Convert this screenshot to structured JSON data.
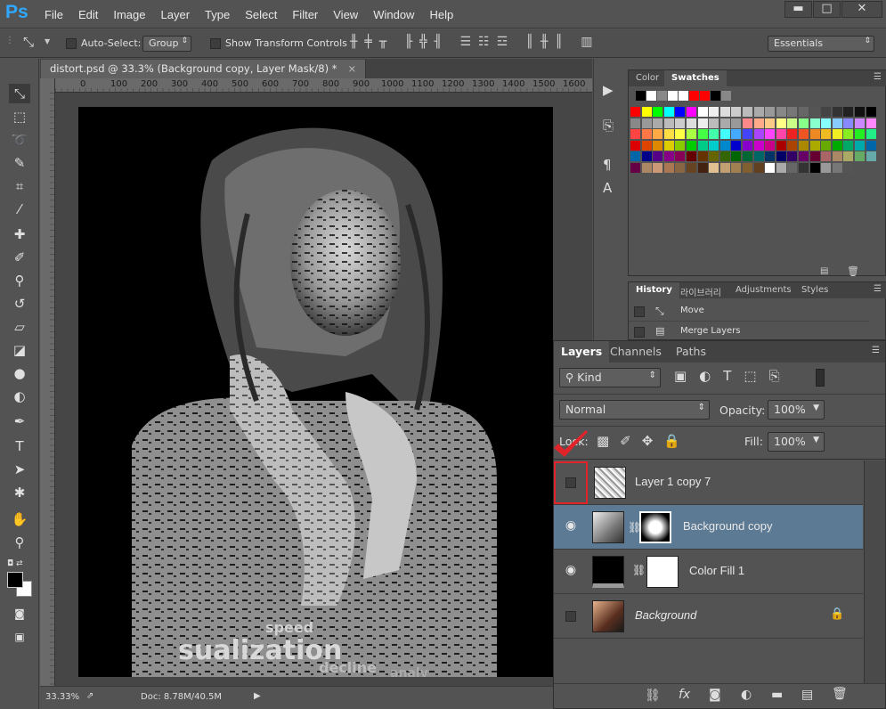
{
  "app": {
    "logo": "Ps"
  },
  "menu": [
    "File",
    "Edit",
    "Image",
    "Layer",
    "Type",
    "Select",
    "Filter",
    "View",
    "Window",
    "Help"
  ],
  "window_controls": {
    "minimize": "▬",
    "restore": "□",
    "close": "✕"
  },
  "options_bar": {
    "auto_select_label": "Auto-Select:",
    "auto_select_value": "Group",
    "show_transform_label": "Show Transform Controls",
    "workspace": "Essentials"
  },
  "document": {
    "tab_title": "distort.psd @ 33.3% (Background copy, Layer Mask/8) *",
    "close": "×"
  },
  "ruler_ticks": [
    "0",
    "100",
    "200",
    "300",
    "400",
    "500",
    "600",
    "700",
    "800",
    "900",
    "1000",
    "1100",
    "1200",
    "1300",
    "1400",
    "1500",
    "1600"
  ],
  "artwork_text": [
    "sualization",
    "decline",
    "speed",
    "analy"
  ],
  "status": {
    "zoom": "33.33%",
    "doc": "Doc: 8.78M/40.5M"
  },
  "swatches_panel": {
    "tabs": [
      "Color",
      "Swatches"
    ],
    "active": "Swatches"
  },
  "history_panel": {
    "tabs": [
      "History",
      "라이브러리",
      "Adjustments",
      "Styles"
    ],
    "items": [
      "Move",
      "Merge Layers"
    ]
  },
  "layers_panel": {
    "tabs": [
      "Layers",
      "Channels",
      "Paths"
    ],
    "filter": "Kind",
    "blend_mode": "Normal",
    "opacity_label": "Opacity:",
    "opacity_value": "100%",
    "lock_label": "Lock:",
    "fill_label": "Fill:",
    "fill_value": "100%",
    "layers": [
      {
        "name": "Layer 1 copy 7",
        "visible": false,
        "selected": false
      },
      {
        "name": "Background copy",
        "visible": true,
        "selected": true
      },
      {
        "name": "Color Fill 1",
        "visible": true,
        "selected": false
      },
      {
        "name": "Background",
        "visible": false,
        "selected": false
      }
    ]
  },
  "colors": {
    "accent": "#31a8ff",
    "selected_layer": "#5d7a94",
    "highlight_red": "#e0242a"
  }
}
